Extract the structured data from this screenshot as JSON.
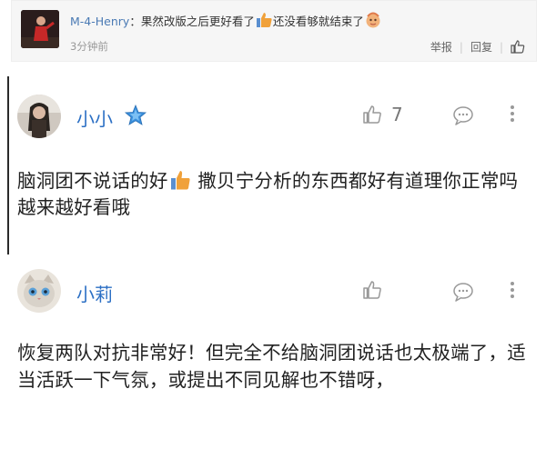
{
  "nested_reply": {
    "username": "M-4-Henry",
    "separator": "：",
    "text_part1": "果然改版之后更好看了",
    "text_part2": "还没看够就结束了",
    "time": "3分钟前",
    "report_label": "举报",
    "reply_label": "回复",
    "divider": "|"
  },
  "comments": [
    {
      "username": "小小",
      "badge": "star-badge-icon",
      "like_count": "7",
      "text_part1": "脑洞团不说话的好",
      "text_part2": " 撒贝宁分析的东西都好有道理你正常吗 越来越好看哦"
    },
    {
      "username": "小莉",
      "like_count": "",
      "text": "恢复两队对抗非常好！但完全不给脑洞团说话也太极端了，适当活跃一下气氛，或提出不同见解也不错呀，"
    }
  ],
  "colors": {
    "username_blue": "#2b6fc4",
    "nested_username": "#4a7ab4",
    "icon_gray": "#9a9a9a",
    "thumb_orange": "#f0a13a",
    "badge_blue": "#3a8fdc"
  }
}
